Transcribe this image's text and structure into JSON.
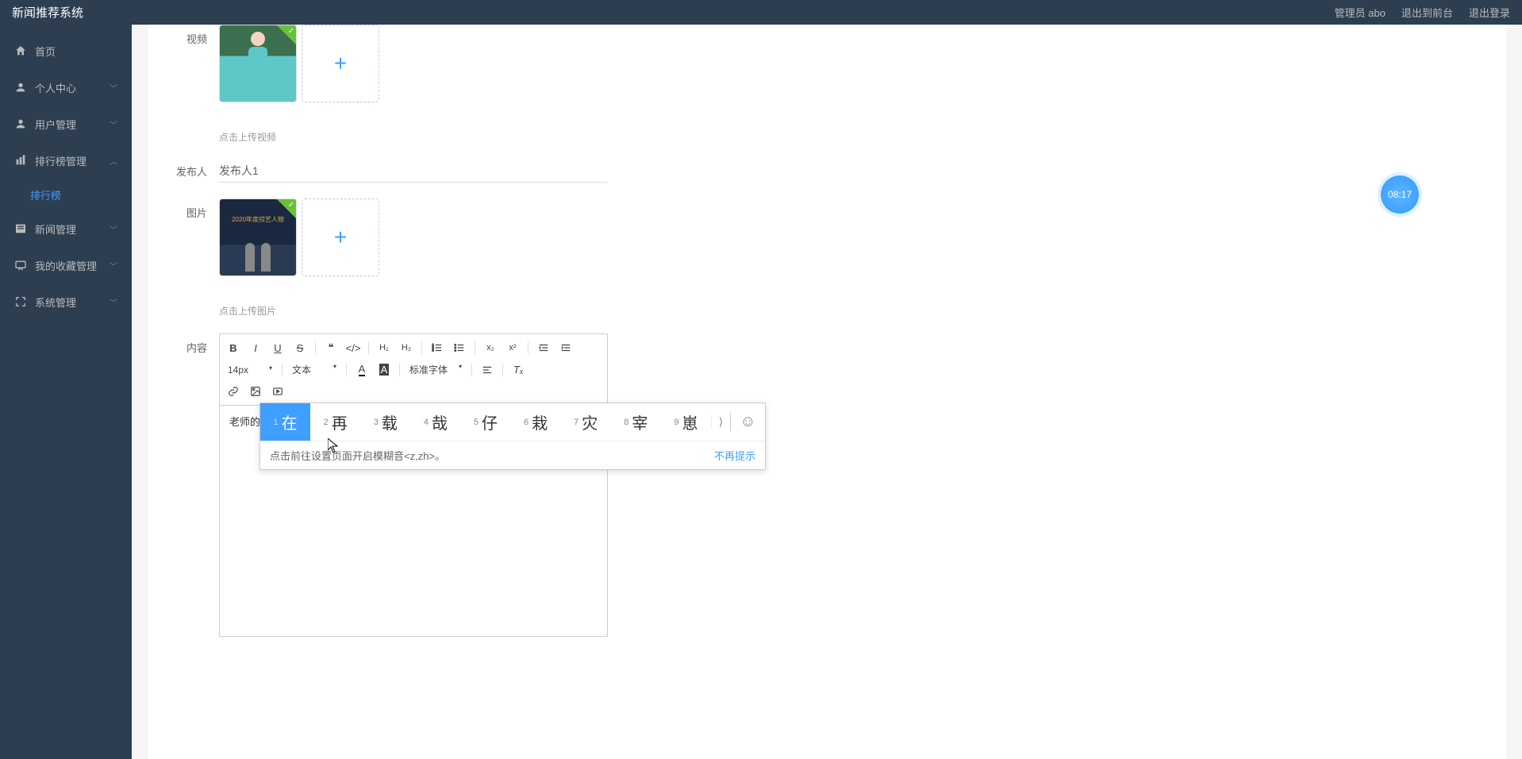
{
  "app": {
    "title": "新闻推荐系统"
  },
  "topbar": {
    "admin_label": "管理员 abo",
    "exit_front": "退出到前台",
    "logout": "退出登录"
  },
  "sidebar": {
    "home": "首页",
    "personal": "个人中心",
    "user_mgmt": "用户管理",
    "ranking_mgmt": "排行榜管理",
    "ranking": "排行榜",
    "news_mgmt": "新闻管理",
    "favorites_mgmt": "我的收藏管理",
    "system_mgmt": "系统管理"
  },
  "form": {
    "video_label": "视频",
    "video_hint": "点击上传视频",
    "publisher_label": "发布人",
    "publisher_value": "发布人1",
    "image_label": "图片",
    "image_hint": "点击上传图片",
    "content_label": "内容",
    "award_caption": "2020年度综艺人物"
  },
  "editor": {
    "font_size": "14px",
    "text_style": "文本",
    "font_family": "标准字体",
    "body_text": "老师的辛苦za"
  },
  "ime": {
    "candidates": [
      {
        "num": "1",
        "char": "在"
      },
      {
        "num": "2",
        "char": "再"
      },
      {
        "num": "3",
        "char": "载"
      },
      {
        "num": "4",
        "char": "哉"
      },
      {
        "num": "5",
        "char": "仔"
      },
      {
        "num": "6",
        "char": "栽"
      },
      {
        "num": "7",
        "char": "灾"
      },
      {
        "num": "8",
        "char": "宰"
      },
      {
        "num": "9",
        "char": "崽"
      }
    ],
    "hint": "点击前往设置页面开启模糊音<z,zh>。",
    "no_remind": "不再提示"
  },
  "clock": "08:17"
}
